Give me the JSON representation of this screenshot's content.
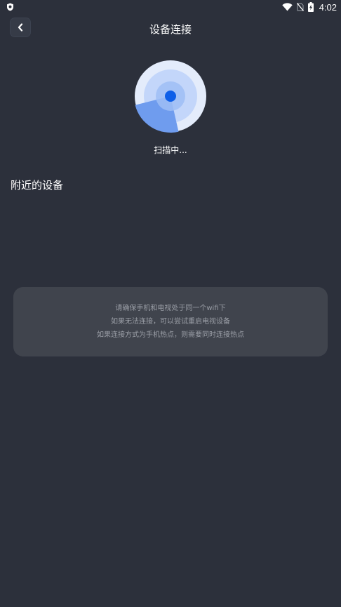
{
  "status_bar": {
    "time": "4:02",
    "icons": [
      "shield-icon",
      "wifi-icon",
      "no-sim-icon",
      "battery-charging-icon"
    ]
  },
  "header": {
    "back_icon": "chevron-left-icon",
    "title": "设备连接"
  },
  "scanner": {
    "status": "扫描中..."
  },
  "nearby": {
    "title": "附近的设备"
  },
  "tips": {
    "lines": [
      "请确保手机和电视处于同一个wifi下",
      "如果无法连接，可以尝试重启电视设备",
      "如果连接方式为手机热点，则需要同时连接热点"
    ]
  },
  "colors": {
    "background": "#2c303b",
    "card": "#40444d",
    "radar_outer": "#e4ecfb",
    "radar_mid": "#c3d6fa",
    "radar_inner": "#9fbef5",
    "radar_center": "#0e5fe8",
    "radar_sweep": "#6f9cee"
  }
}
